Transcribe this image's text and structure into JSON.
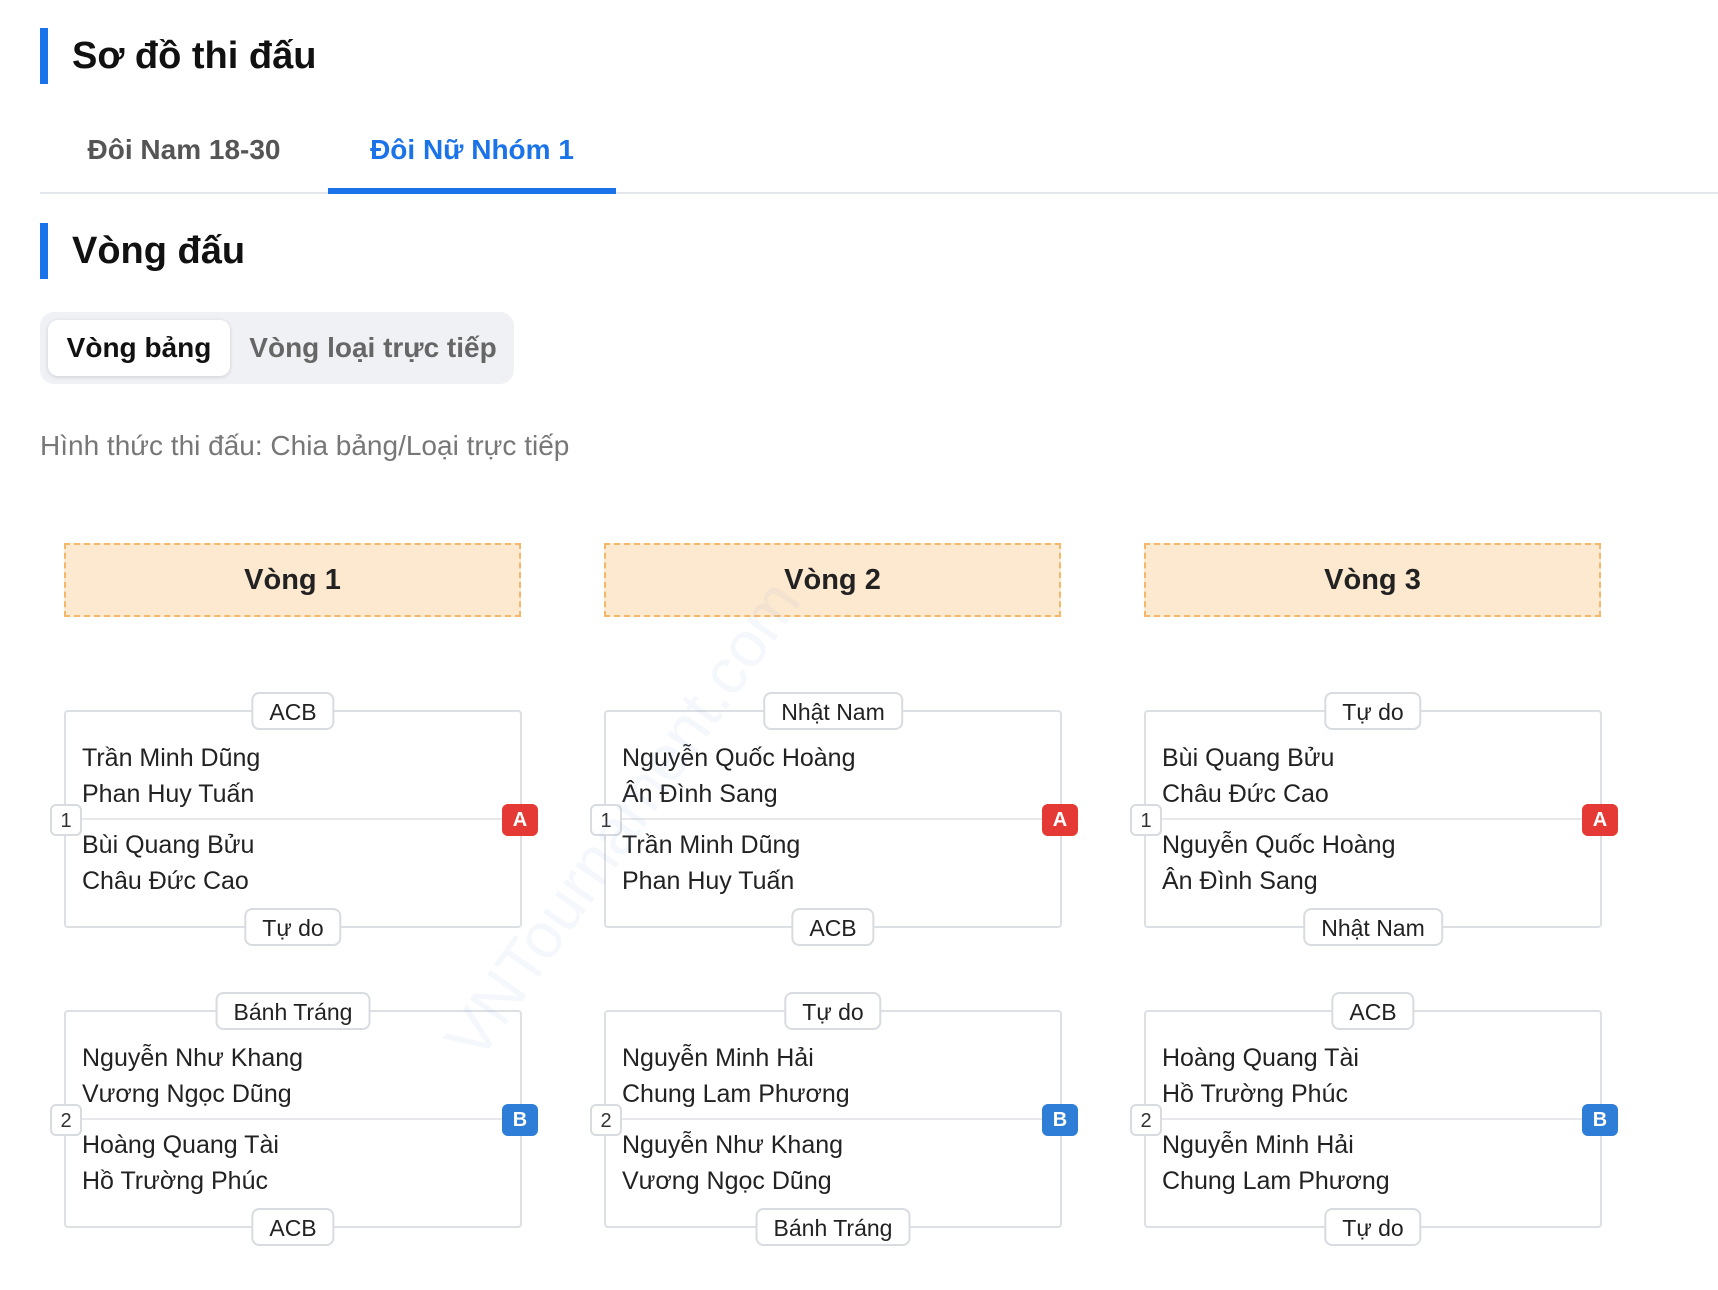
{
  "page_title": "Sơ đồ thi đấu",
  "tabs": [
    {
      "label": "Đôi Nam 18-30",
      "active": false
    },
    {
      "label": "Đôi Nữ Nhóm 1",
      "active": true
    }
  ],
  "section_title": "Vòng đấu",
  "segment": [
    {
      "label": "Vòng bảng",
      "active": true
    },
    {
      "label": "Vòng loại trực tiếp",
      "active": false
    }
  ],
  "format_text": "Hình thức thi đấu: Chia bảng/Loại trực tiếp",
  "watermark": "VNTournament.com",
  "colors": {
    "accent": "#1a73e8",
    "group_a": "#e53935",
    "group_b": "#2e7dd7",
    "round_header_bg": "#fde9d0"
  },
  "rounds": [
    {
      "title": "Vòng 1",
      "matches": [
        {
          "number": "1",
          "group": "A",
          "top_club": "ACB",
          "top_players": [
            "Trần Minh Dũng",
            "Phan Huy Tuấn"
          ],
          "bottom_players": [
            "Bùi Quang Bửu",
            "Châu Đức Cao"
          ],
          "bottom_club": "Tự do"
        },
        {
          "number": "2",
          "group": "B",
          "top_club": "Bánh Tráng",
          "top_players": [
            "Nguyễn Như Khang",
            "Vương Ngọc Dũng"
          ],
          "bottom_players": [
            "Hoàng Quang Tài",
            "Hồ Trường Phúc"
          ],
          "bottom_club": "ACB"
        }
      ]
    },
    {
      "title": "Vòng 2",
      "matches": [
        {
          "number": "1",
          "group": "A",
          "top_club": "Nhật Nam",
          "top_players": [
            "Nguyễn Quốc Hoàng",
            "Ân Đình Sang"
          ],
          "bottom_players": [
            "Trần Minh Dũng",
            "Phan Huy Tuấn"
          ],
          "bottom_club": "ACB"
        },
        {
          "number": "2",
          "group": "B",
          "top_club": "Tự do",
          "top_players": [
            "Nguyễn Minh Hải",
            "Chung Lam Phương"
          ],
          "bottom_players": [
            "Nguyễn Như Khang",
            "Vương Ngọc Dũng"
          ],
          "bottom_club": "Bánh Tráng"
        }
      ]
    },
    {
      "title": "Vòng 3",
      "matches": [
        {
          "number": "1",
          "group": "A",
          "top_club": "Tự do",
          "top_players": [
            "Bùi Quang Bửu",
            "Châu Đức Cao"
          ],
          "bottom_players": [
            "Nguyễn Quốc Hoàng",
            "Ân Đình Sang"
          ],
          "bottom_club": "Nhật Nam"
        },
        {
          "number": "2",
          "group": "B",
          "top_club": "ACB",
          "top_players": [
            "Hoàng Quang Tài",
            "Hồ Trường Phúc"
          ],
          "bottom_players": [
            "Nguyễn Minh Hải",
            "Chung Lam Phương"
          ],
          "bottom_club": "Tự do"
        }
      ]
    }
  ]
}
